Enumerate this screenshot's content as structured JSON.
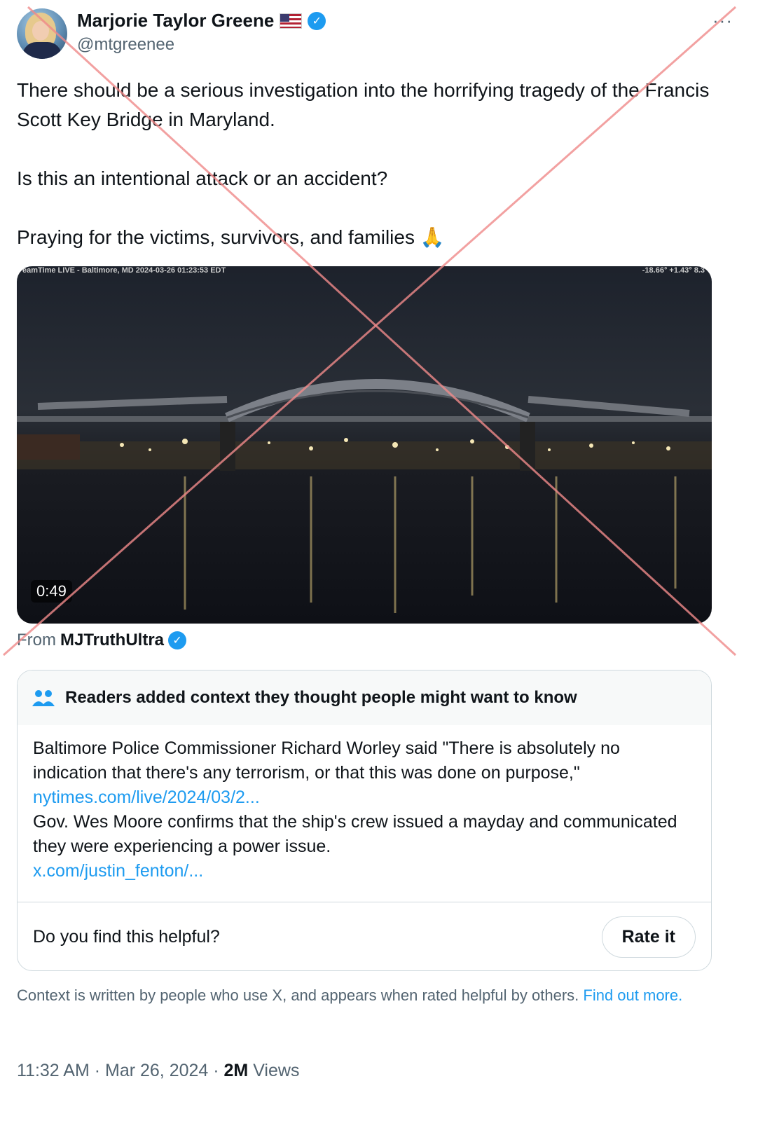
{
  "author": {
    "name": "Marjorie Taylor Greene",
    "handle": "@mtgreenee",
    "flag_icon": "us-flag-icon",
    "verified_icon": "verified-badge-icon"
  },
  "more_label": "···",
  "tweet": {
    "line1": "There should be a serious investigation into the horrifying tragedy of the Francis Scott Key Bridge in Maryland.",
    "line2": "Is this an intentional attack or an accident?",
    "line3": "Praying for the victims, survivors, and families 🙏"
  },
  "media": {
    "overlay_left": "eamTime LIVE - Baltimore, MD 2024-03-26 01:23:53 EDT",
    "overlay_right": "-18.66° +1.43° 8.3",
    "duration": "0:49"
  },
  "from": {
    "label": "From",
    "account": "MJTruthUltra"
  },
  "note": {
    "title": "Readers added context they thought people might want to know",
    "text1": "Baltimore Police Commissioner Richard Worley said \"There is absolutely no indication that there's any terrorism, or that this was done on purpose,\"",
    "link1": "nytimes.com/live/2024/03/2...",
    "text2": "Gov. Wes Moore confirms that the ship's crew issued a mayday and communicated they were experiencing a power issue.",
    "link2": "x.com/justin_fenton/...",
    "question": "Do you find this helpful?",
    "rate_label": "Rate it"
  },
  "disclaimer": {
    "text": "Context is written by people who use X, and appears when rated helpful by others.",
    "link": "Find out more."
  },
  "meta": {
    "time": "11:32 AM · Mar 26, 2024 · ",
    "views_count": "2M",
    "views_label": " Views"
  },
  "colors": {
    "accent": "#1d9bf0",
    "cross": "#f08a8a"
  }
}
